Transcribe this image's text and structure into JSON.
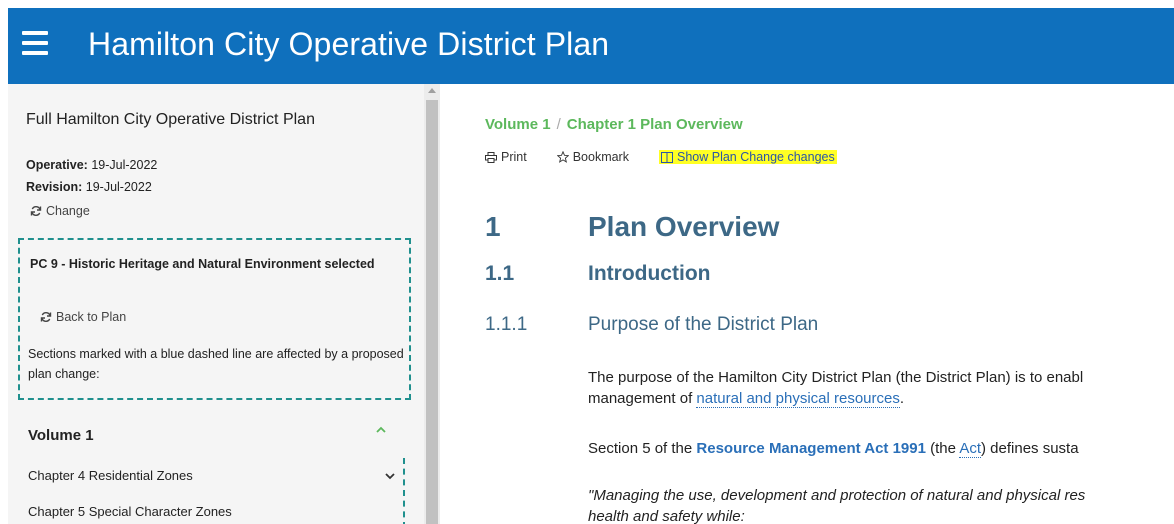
{
  "header": {
    "title": "Hamilton City Operative District Plan",
    "menu_icon": "hamburger-menu-icon",
    "background_color": "#0f70bd"
  },
  "sidebar": {
    "title": "Full Hamilton City Operative District Plan",
    "operative_label": "Operative:",
    "operative_date": "19-Jul-2022",
    "revision_label": "Revision:",
    "revision_date": "19-Jul-2022",
    "change_label": "Change",
    "plan_change": {
      "title": "PC 9 - Historic Heritage and Natural Environment selected",
      "back_label": "Back to Plan",
      "description": "Sections marked with a blue dashed line are affected by a proposed plan change:",
      "border_color": "#20908e"
    },
    "nav": {
      "volume_label": "Volume 1",
      "items": [
        {
          "label": "Chapter 4 Residential Zones"
        },
        {
          "label": "Chapter 5 Special Character Zones"
        }
      ]
    }
  },
  "main": {
    "breadcrumb": {
      "volume": "Volume 1",
      "separator": "/",
      "chapter": "Chapter 1 Plan Overview"
    },
    "toolbar": {
      "print_label": "Print",
      "bookmark_label": "Bookmark",
      "show_changes_label": "Show Plan Change changes",
      "highlight_color": "#ffff24"
    },
    "headings": {
      "h1_number": "1",
      "h1_text": "Plan Overview",
      "h2_number": "1.1",
      "h2_text": "Introduction",
      "h3_number": "1.1.1",
      "h3_text": "Purpose of the District Plan"
    },
    "para1": {
      "line1": "The purpose of the Hamilton City District Plan (the District Plan) is to enabl",
      "line2_pre": "management of ",
      "line2_link": "natural and physical resources",
      "line2_post": "."
    },
    "para2": {
      "pre": "Section 5 of the ",
      "link": "Resource Management Act 1991",
      "mid": " (the ",
      "act_link": "Act",
      "post": ") defines susta"
    },
    "quote": {
      "line1": "\"Managing the use, development and protection of natural and physical res",
      "line2": "health and safety while:"
    },
    "heading_color": "#3d6886",
    "breadcrumb_color": "#5cb85c",
    "link_color": "#2a6fb8"
  }
}
